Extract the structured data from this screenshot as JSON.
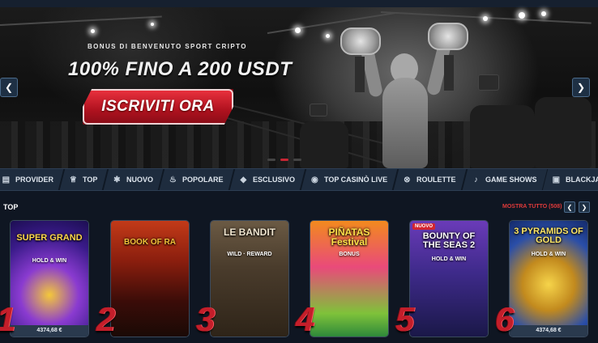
{
  "hero": {
    "subtitle": "BONUS DI BENVENUTO SPORT CRIPTO",
    "title": "100% FINO A 200 USDT",
    "cta_label": "ISCRIVITI ORA",
    "prev_icon": "chevron-left-icon",
    "next_icon": "chevron-right-icon",
    "prev_glyph": "❮",
    "next_glyph": "❯"
  },
  "categories": [
    {
      "label": "PROVIDER",
      "icon": "provider-icon",
      "glyph": "▤"
    },
    {
      "label": "TOP",
      "icon": "trophy-icon",
      "glyph": "♕"
    },
    {
      "label": "NUOVO",
      "icon": "new-icon",
      "glyph": "✱"
    },
    {
      "label": "POPOLARE",
      "icon": "flame-icon",
      "glyph": "♨"
    },
    {
      "label": "ESCLUSIVO",
      "icon": "diamond-icon",
      "glyph": "◆"
    },
    {
      "label": "TOP CASINÒ LIVE",
      "icon": "live-casino-icon",
      "glyph": "◉"
    },
    {
      "label": "ROULETTE",
      "icon": "roulette-icon",
      "glyph": "⊗"
    },
    {
      "label": "GAME SHOWS",
      "icon": "microphone-icon",
      "glyph": "♪"
    },
    {
      "label": "BLACKJACK",
      "icon": "cards-icon",
      "glyph": "▣"
    },
    {
      "label": "",
      "icon": "more-icon",
      "glyph": "◢"
    }
  ],
  "section": {
    "title": "TOP",
    "show_all": "MOSTRA TUTTO (508)",
    "prev_glyph": "❮",
    "next_glyph": "❯"
  },
  "games": [
    {
      "rank": "1",
      "title": "SUPER GRAND",
      "subtitle": "HOLD & WIN",
      "price": "4374,68 €",
      "badge": ""
    },
    {
      "rank": "2",
      "title": "BOOK OF RA",
      "subtitle": "",
      "price": "",
      "badge": ""
    },
    {
      "rank": "3",
      "title": "LE BANDIT",
      "subtitle": "WILD · REWARD",
      "price": "",
      "badge": ""
    },
    {
      "rank": "4",
      "title": "PIÑATAS Festival",
      "subtitle": "BONUS",
      "price": "",
      "badge": ""
    },
    {
      "rank": "5",
      "title": "BOUNTY OF THE SEAS 2",
      "subtitle": "HOLD & WIN",
      "price": "",
      "badge": "NUOVO"
    },
    {
      "rank": "6",
      "title": "3 PYRAMIDS OF GOLD",
      "subtitle": "HOLD & WIN",
      "price": "4374,68 €",
      "badge": ""
    }
  ],
  "colors": {
    "accent_red": "#c41e2a",
    "bar_bg": "#1a2636",
    "page_bg": "#0f1622"
  }
}
